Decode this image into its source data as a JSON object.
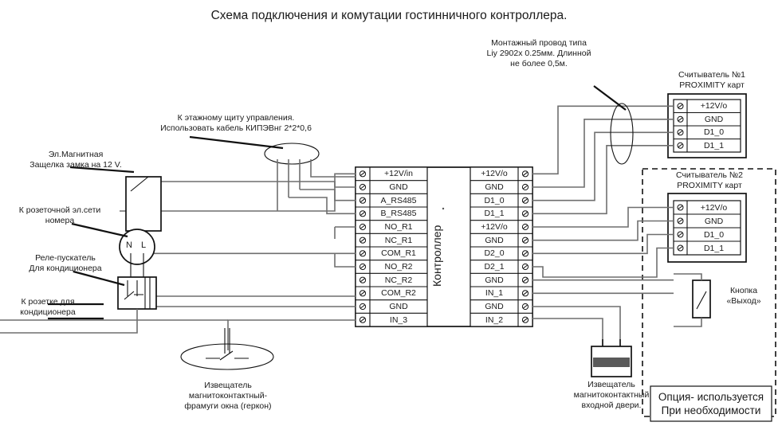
{
  "title": "Схема подключения и комутации гостинничного контроллера.",
  "colors": {
    "line": "#6f6f6f",
    "outline": "#000000",
    "text": "#1a1a1a",
    "sensor_fill": "#5a5a5a"
  },
  "annotations": {
    "mount_wire": "Монтажный провод типа\nLiy 2902x 0.25мм. Длинной\nне более 0,5м.",
    "floor_panel": "К этажному щиту управления.\nИспользовать кабель КИПЭВнг 2*2*0,6",
    "mag_latch": "Эл.Магнитная\nЗащелка замка на 12 V.",
    "socket_net": "К розеточной эл.сети\nномера",
    "relay_starter": "Реле-пускатель\nДля кондиционера",
    "socket_ac": "К розетке для\nкондиционера",
    "window_sensor": "Извещатель\nмагнитоконтактный-\nфрамуги окна (геркон)",
    "door_sensor": "Извещатель\nмагнитоконтактный\nвходной двери.",
    "exit_button": "Кнопка\n«Выход»",
    "option_note": "Опция- используется\nПри необходимости"
  },
  "controller": {
    "name": "Контроллер",
    "left_terminals": [
      "+12V/in",
      "GND",
      "A_RS485",
      "B_RS485",
      "NO_R1",
      "NC_R1",
      "COM_R1",
      "NO_R2",
      "NC_R2",
      "COM_R2",
      "GND",
      "IN_3"
    ],
    "right_terminals": [
      "+12V/o",
      "GND",
      "D1_0",
      "D1_1",
      "+12V/o",
      "GND",
      "D2_0",
      "D2_1",
      "GND",
      "IN_1",
      "GND",
      "IN_2"
    ]
  },
  "reader1": {
    "title": "Считыватель №1\nPROXIMITY  карт",
    "terminals": [
      "+12V/o",
      "GND",
      "D1_0",
      "D1_1"
    ]
  },
  "reader2": {
    "title": "Считыватель №2\nPROXIMITY  карт",
    "terminals": [
      "+12V/o",
      "GND",
      "D1_0",
      "D1_1"
    ]
  },
  "relay_labels": {
    "n": "N",
    "l": "L"
  },
  "icons": {
    "screw": "screw-terminal-icon",
    "reed": "reed-switch-icon",
    "magnet": "magnet-contact-icon",
    "button": "push-button-icon",
    "cable_bundle": "cable-bundle-icon"
  }
}
